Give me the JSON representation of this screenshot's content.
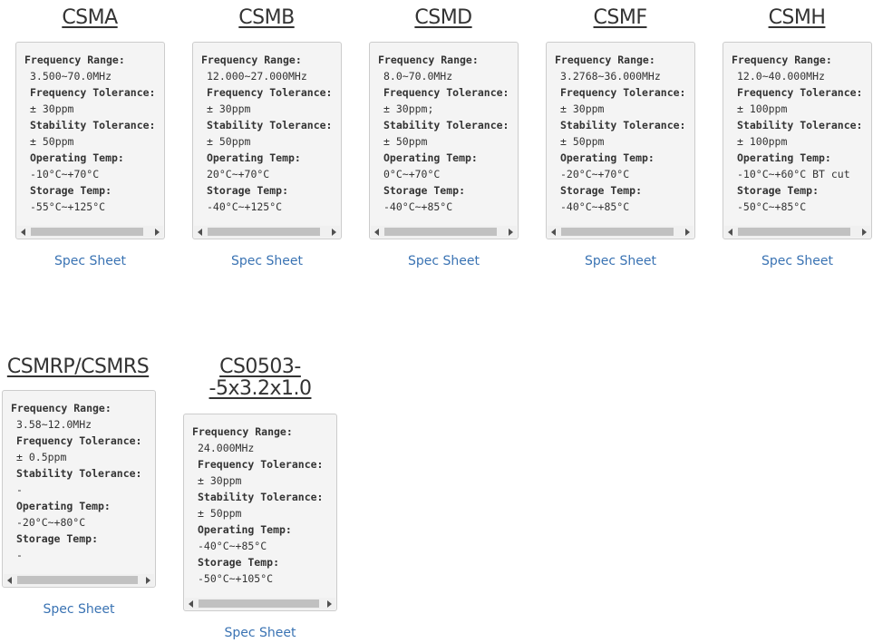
{
  "labels": {
    "freq_range": "Frequency Range:",
    "freq_tol": "Frequency Tolerance:",
    "stab_tol": "Stability Tolerance:",
    "op_temp": "Operating Temp:",
    "storage_temp": "Storage Temp:"
  },
  "products": [
    {
      "title": "CSMA",
      "freq_range": "3.500~70.0MHz",
      "freq_tol": "± 30ppm",
      "stab_tol": "± 50ppm",
      "op_temp": "-10°C~+70°C",
      "storage_temp": "-55°C~+125°C",
      "link": "Spec Sheet"
    },
    {
      "title": "CSMB",
      "freq_range": "12.000~27.000MHz",
      "freq_tol": "± 30ppm",
      "stab_tol": "± 50ppm",
      "op_temp": "20°C~+70°C",
      "storage_temp": "-40°C~+125°C",
      "link": "Spec Sheet"
    },
    {
      "title": "CSMD",
      "freq_range": "8.0~70.0MHz",
      "freq_tol": "± 30ppm;",
      "stab_tol": "± 50ppm",
      "op_temp": "0°C~+70°C",
      "storage_temp": "-40°C~+85°C",
      "link": "Spec Sheet"
    },
    {
      "title": "CSMF",
      "freq_range": "3.2768~36.000MHz",
      "freq_tol": "± 30ppm",
      "stab_tol": "± 50ppm",
      "op_temp": "-20°C~+70°C",
      "storage_temp": "-40°C~+85°C",
      "link": "Spec Sheet"
    },
    {
      "title": "CSMH",
      "freq_range": "12.0~40.000MHz",
      "freq_tol": "± 100ppm",
      "stab_tol": "± 100ppm",
      "op_temp": "-10°C~+60°C BT cut",
      "storage_temp": "-50°C~+85°C",
      "link": "Spec Sheet"
    },
    {
      "title": "CSMRP/CSMRS",
      "freq_range": "3.58~12.0MHz",
      "freq_tol": "± 0.5ppm",
      "stab_tol": "-",
      "op_temp": "-20°C~+80°C",
      "storage_temp": "-",
      "link": "Spec Sheet"
    },
    {
      "title_line1": "CS0503-",
      "title_line2": "-5x3.2x1.0",
      "freq_range": "24.000MHz",
      "freq_tol": "± 30ppm",
      "stab_tol": "± 50ppm",
      "op_temp": "-40°C~+85°C",
      "storage_temp": "-50°C~+105°C",
      "link": "Spec Sheet"
    }
  ]
}
